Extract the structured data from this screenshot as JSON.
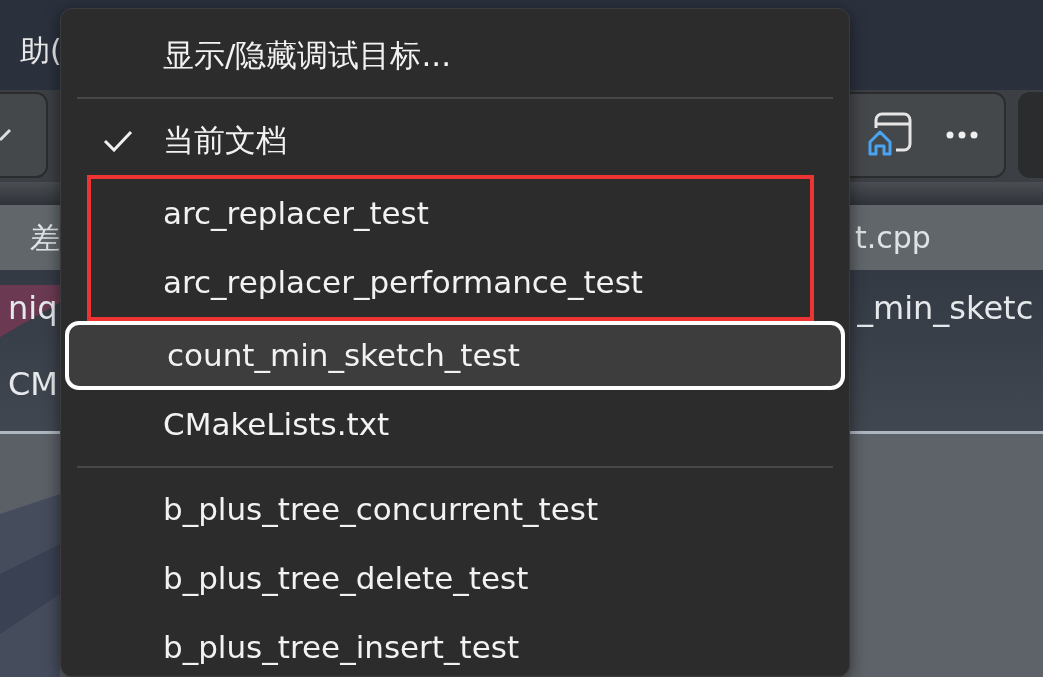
{
  "background": {
    "menu_bar_text": "助(",
    "tab_texts": [
      "差",
      "t.cpp"
    ],
    "editor_lines": [
      {
        "left": "niq",
        "right": "_min_sketc"
      },
      {
        "left": "CM"
      }
    ]
  },
  "menu": {
    "items": [
      {
        "kind": "item",
        "label": "显示/隐藏调试目标...",
        "checked": false,
        "selected": false,
        "annotated": false
      },
      {
        "kind": "separator"
      },
      {
        "kind": "item",
        "label": "当前文档",
        "checked": true,
        "selected": false,
        "annotated": false
      },
      {
        "kind": "item",
        "label": "arc_replacer_test",
        "checked": false,
        "selected": false,
        "annotated": true
      },
      {
        "kind": "item",
        "label": "arc_replacer_performance_test",
        "checked": false,
        "selected": false,
        "annotated": true
      },
      {
        "kind": "item",
        "label": "count_min_sketch_test",
        "checked": false,
        "selected": true,
        "annotated": false
      },
      {
        "kind": "item",
        "label": "CMakeLists.txt",
        "checked": false,
        "selected": false,
        "annotated": false
      },
      {
        "kind": "separator"
      },
      {
        "kind": "item",
        "label": "b_plus_tree_concurrent_test",
        "checked": false,
        "selected": false,
        "annotated": false
      },
      {
        "kind": "item",
        "label": "b_plus_tree_delete_test",
        "checked": false,
        "selected": false,
        "annotated": false
      },
      {
        "kind": "item",
        "label": "b_plus_tree_insert_test",
        "checked": false,
        "selected": false,
        "annotated": false
      }
    ]
  }
}
